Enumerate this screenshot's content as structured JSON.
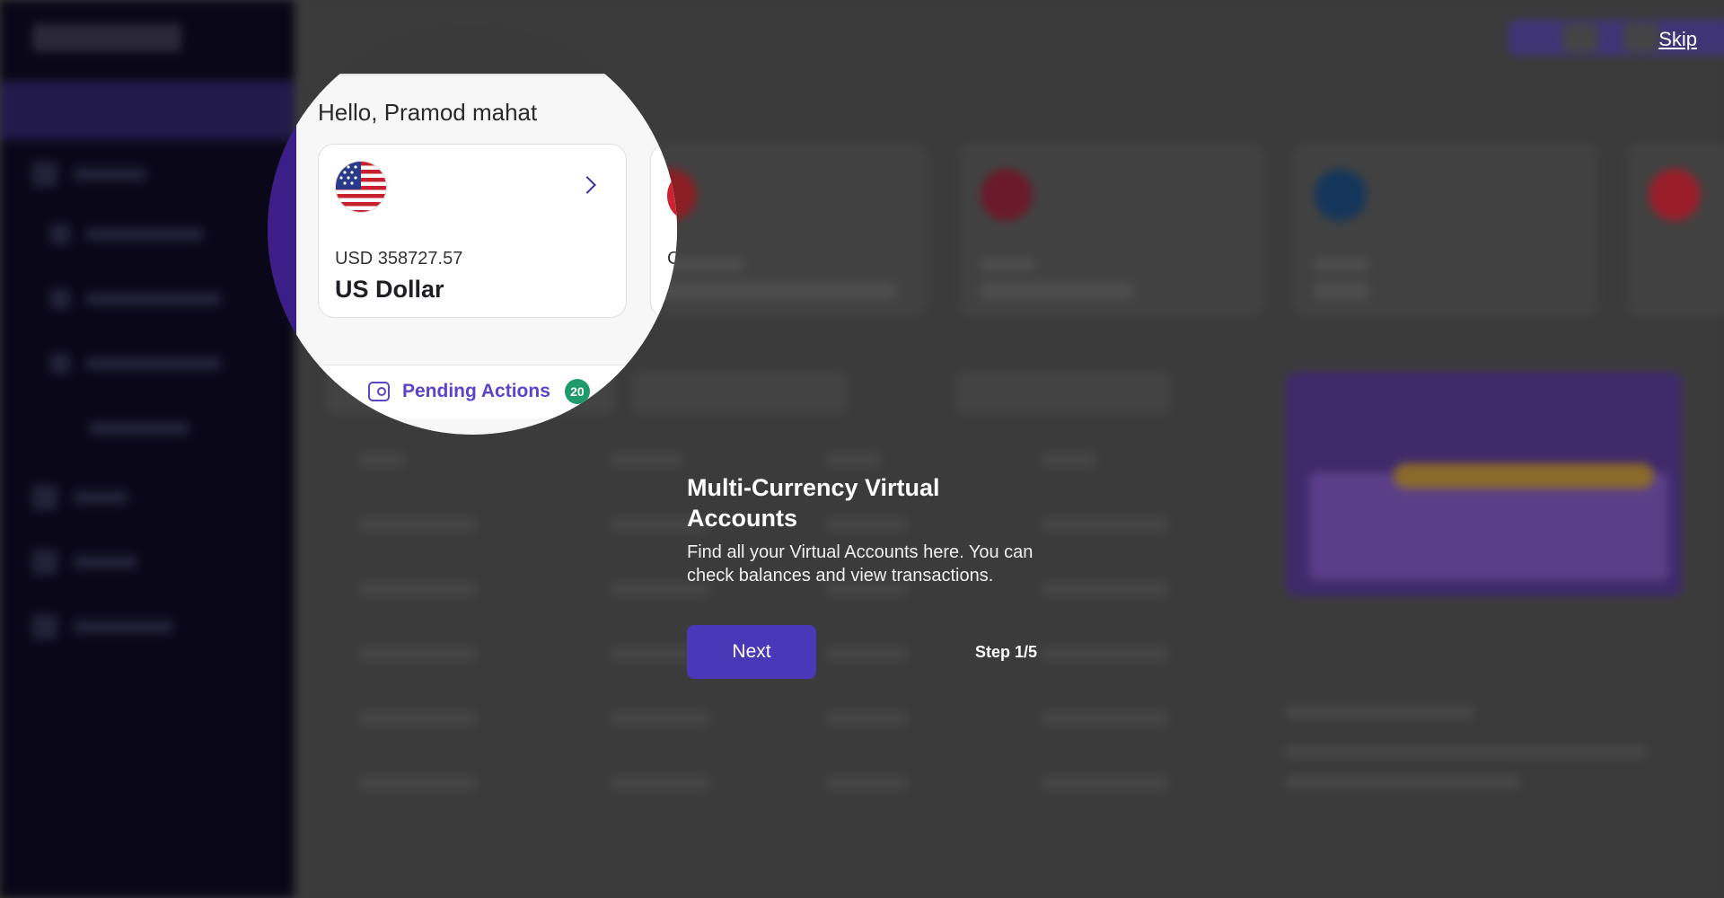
{
  "overlay": {
    "skip_label": "Skip"
  },
  "spotlight": {
    "greeting": "Hello, Pramod mahat",
    "account_card": {
      "flag_icon": "us-flag-icon",
      "amount": "USD 358727.57",
      "currency_name": "US Dollar"
    },
    "partial_card_fragment": "C",
    "pending_actions": {
      "label": "Pending Actions",
      "count": "20"
    }
  },
  "tooltip": {
    "title": "Multi-Currency Virtual Accounts",
    "body": "Find all your Virtual Accounts here. You can check balances and view transactions.",
    "next_label": "Next",
    "step": "Step 1/5"
  },
  "colors": {
    "accent": "#4b38b8",
    "badge": "#1f9a6a",
    "sidebar": "#0a0818",
    "overlay": "#3a3a3a"
  }
}
